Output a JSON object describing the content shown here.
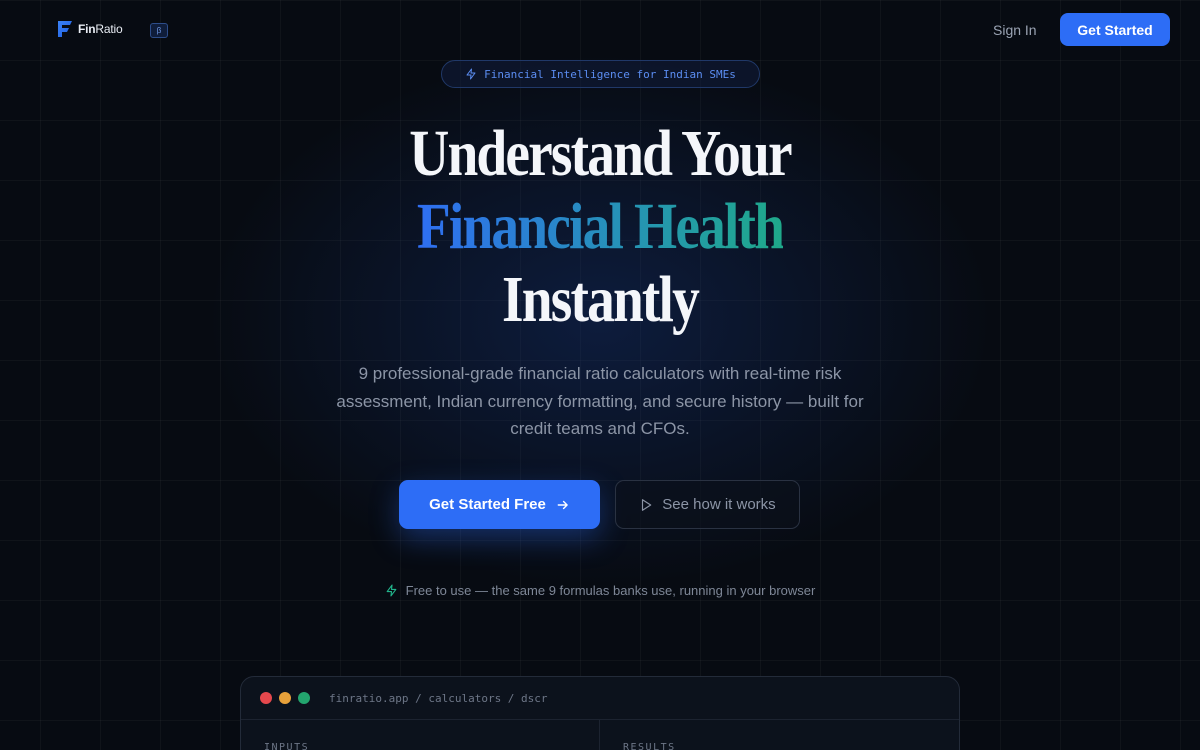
{
  "brand": {
    "name_bold": "Fin",
    "name_rest": "Ratio",
    "badge": "β",
    "accent": "#2d6df6"
  },
  "nav": {
    "signin_label": "Sign In",
    "cta_label": "Get Started"
  },
  "hero": {
    "pill_icon": "lightning-icon",
    "pill_text": "Financial Intelligence for Indian SMEs",
    "title_line1": "Understand Your",
    "title_line2": "Financial Health",
    "title_line3": "Instantly",
    "title_gradient": [
      "#2f6ef2",
      "#1fa98a"
    ],
    "subtitle": "9 professional-grade financial ratio calculators with real-time risk assessment, Indian currency formatting, and secure history — built for credit teams and CFOs.",
    "primary_cta": "Get Started Free",
    "secondary_cta": "See how it works",
    "note": "Free to use — the same 9 formulas banks use, running in your browser",
    "note_icon_color": "#22b58c"
  },
  "preview": {
    "window_dots": [
      "#e5484d",
      "#e7a13a",
      "#23a56e"
    ],
    "url": "finratio.app / calculators / dscr",
    "left_pane_label": "INPUTS",
    "right_pane_label": "RESULTS"
  }
}
